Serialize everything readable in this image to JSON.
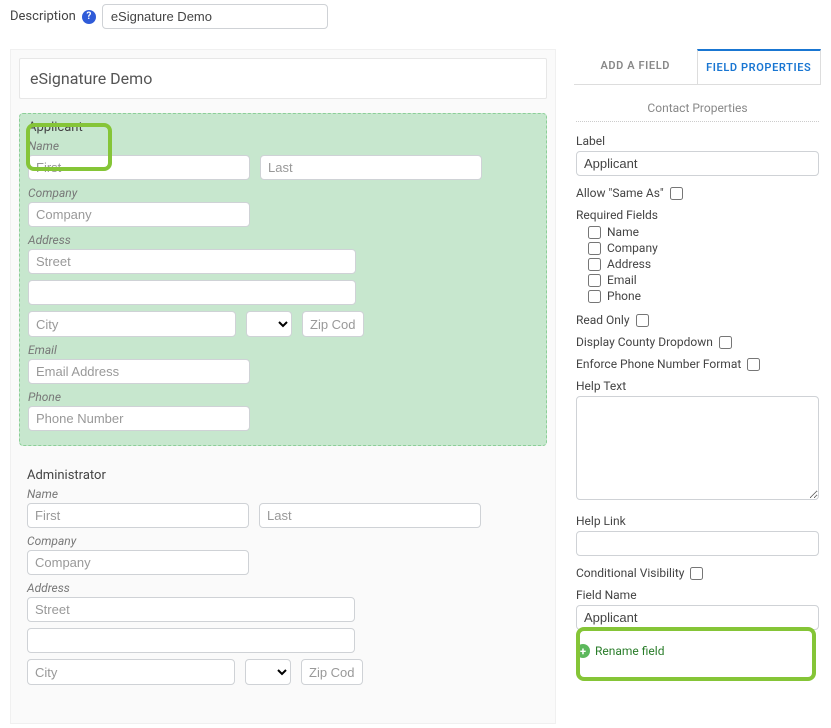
{
  "description": {
    "label": "Description",
    "value": "eSignature Demo"
  },
  "form": {
    "title": "eSignature Demo",
    "applicant": {
      "title": "Applicant",
      "name_label": "Name",
      "first_ph": "First",
      "last_ph": "Last",
      "company_label": "Company",
      "company_ph": "Company",
      "address_label": "Address",
      "street_ph": "Street",
      "city_ph": "City",
      "zip_ph": "Zip Code",
      "email_label": "Email",
      "email_ph": "Email Address",
      "phone_label": "Phone",
      "phone_ph": "Phone Number"
    },
    "admin": {
      "title": "Administrator",
      "name_label": "Name",
      "first_ph": "First",
      "last_ph": "Last",
      "company_label": "Company",
      "company_ph": "Company",
      "address_label": "Address",
      "street_ph": "Street",
      "city_ph": "City",
      "zip_ph": "Zip Code"
    }
  },
  "right": {
    "tabs": {
      "add": "ADD A FIELD",
      "props": "FIELD PROPERTIES"
    },
    "section": "Contact Properties",
    "label_label": "Label",
    "label_value": "Applicant",
    "same_as": "Allow \"Same As\"",
    "required_fields": "Required Fields",
    "rf": {
      "name": "Name",
      "company": "Company",
      "address": "Address",
      "email": "Email",
      "phone": "Phone"
    },
    "read_only": "Read Only",
    "county": "Display County Dropdown",
    "enforce_phone": "Enforce Phone Number Format",
    "help_text": "Help Text",
    "help_link": "Help Link",
    "cond_vis": "Conditional Visibility",
    "field_name_label": "Field Name",
    "field_name_value": "Applicant",
    "rename": "Rename field"
  }
}
